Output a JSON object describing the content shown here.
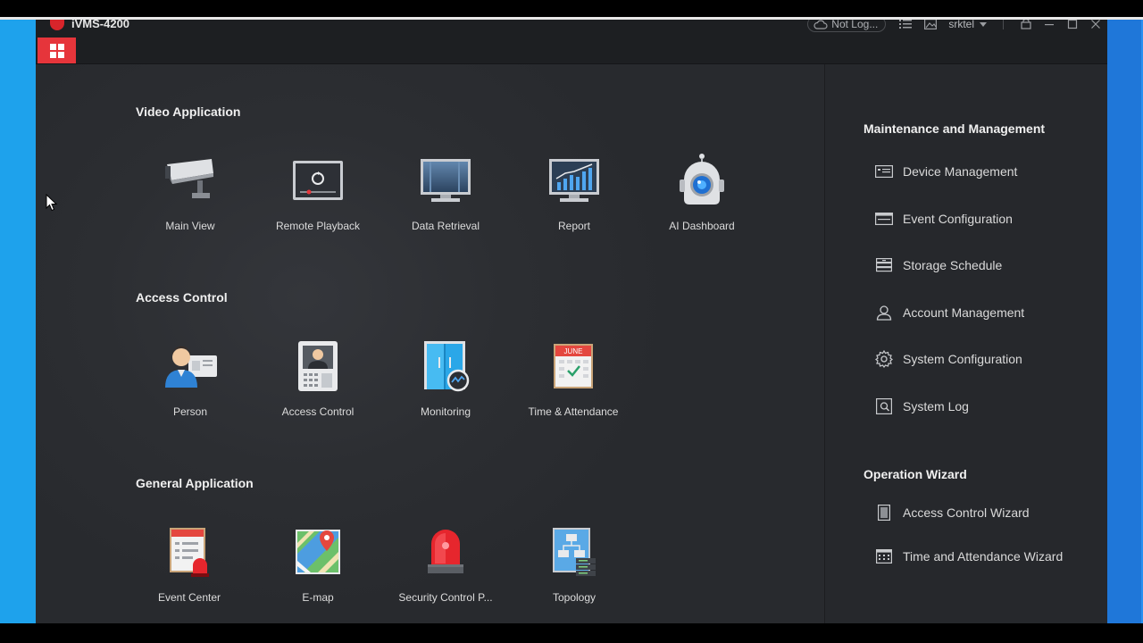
{
  "app": {
    "title": "iVMS-4200"
  },
  "titlebar": {
    "login_status": "Not Log...",
    "username": "srktel"
  },
  "sections": {
    "video": {
      "title": "Video Application",
      "items": [
        "Main View",
        "Remote Playback",
        "Data Retrieval",
        "Report",
        "AI Dashboard"
      ]
    },
    "access": {
      "title": "Access Control",
      "items": [
        "Person",
        "Access Control",
        "Monitoring",
        "Time & Attendance"
      ]
    },
    "general": {
      "title": "General Application",
      "items": [
        "Event Center",
        "E-map",
        "Security Control P...",
        "Topology"
      ]
    }
  },
  "calendar_month": "JUNE",
  "sidebar": {
    "maintenance_title": "Maintenance and Management",
    "maintenance_items": [
      "Device Management",
      "Event Configuration",
      "Storage Schedule",
      "Account Management",
      "System Configuration",
      "System Log"
    ],
    "wizard_title": "Operation Wizard",
    "wizard_items": [
      "Access Control Wizard",
      "Time and Attendance Wizard"
    ]
  },
  "colors": {
    "accent": "#e6353b",
    "app_bg": "#2a2c30",
    "sidebar_bg": "#26282c",
    "desktop_left": "#1ea2ec",
    "desktop_right": "#1f77d9"
  }
}
